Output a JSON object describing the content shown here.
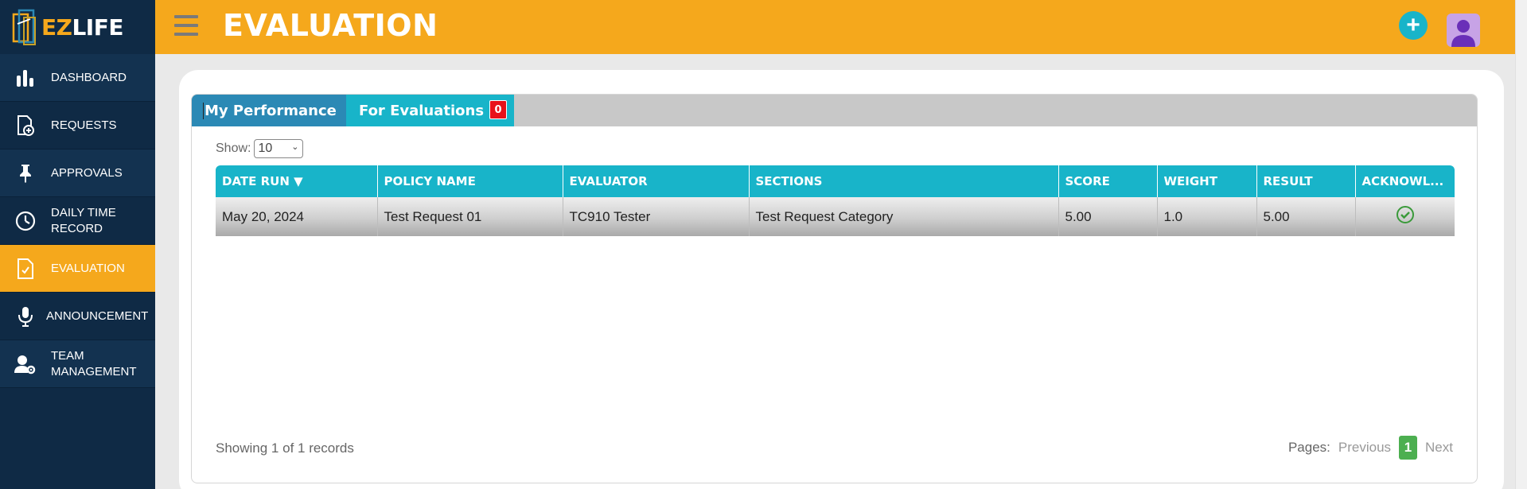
{
  "brand": {
    "logo_ez": "EZ",
    "logo_life": "LIFE"
  },
  "sidebar": {
    "items": [
      {
        "label": "DASHBOARD",
        "icon": "bar-chart-icon"
      },
      {
        "label": "REQUESTS",
        "icon": "request-doc-icon"
      },
      {
        "label": "APPROVALS",
        "icon": "pin-icon"
      },
      {
        "label": "DAILY TIME RECORD",
        "icon": "clock-icon"
      },
      {
        "label": "EVALUATION",
        "icon": "evaluation-doc-icon",
        "active": true
      },
      {
        "label": "ANNOUNCEMENT",
        "icon": "microphone-icon"
      },
      {
        "label": "TEAM MANAGEMENT",
        "icon": "user-gear-icon"
      }
    ]
  },
  "header": {
    "title": "EVALUATION",
    "add_symbol": "+"
  },
  "tabs": [
    {
      "label": "My Performance",
      "active": true
    },
    {
      "label": "For Evaluations",
      "badge": "0"
    }
  ],
  "show": {
    "label": "Show:",
    "value": "10"
  },
  "table": {
    "columns": [
      "DATE RUN ▼",
      "POLICY NAME",
      "EVALUATOR",
      "SECTIONS",
      "SCORE",
      "WEIGHT",
      "RESULT",
      "ACKNOWL..."
    ],
    "rows": [
      [
        "May 20, 2024",
        "Test Request 01",
        "TC910 Tester",
        "Test Request Category",
        "5.00",
        "1.0",
        "5.00",
        "check-circle-icon"
      ]
    ]
  },
  "footer": {
    "records_text": "Showing 1 of 1 records",
    "pages_label": "Pages:",
    "previous": "Previous",
    "current_page": "1",
    "next": "Next"
  },
  "colors": {
    "accent_orange": "#f5a81c",
    "sidebar_navy": "#0f2a45",
    "teal": "#18b4c9",
    "active_tab_blue": "#2b89b5",
    "badge_red": "#e8121a",
    "page_green": "#4caf50"
  }
}
